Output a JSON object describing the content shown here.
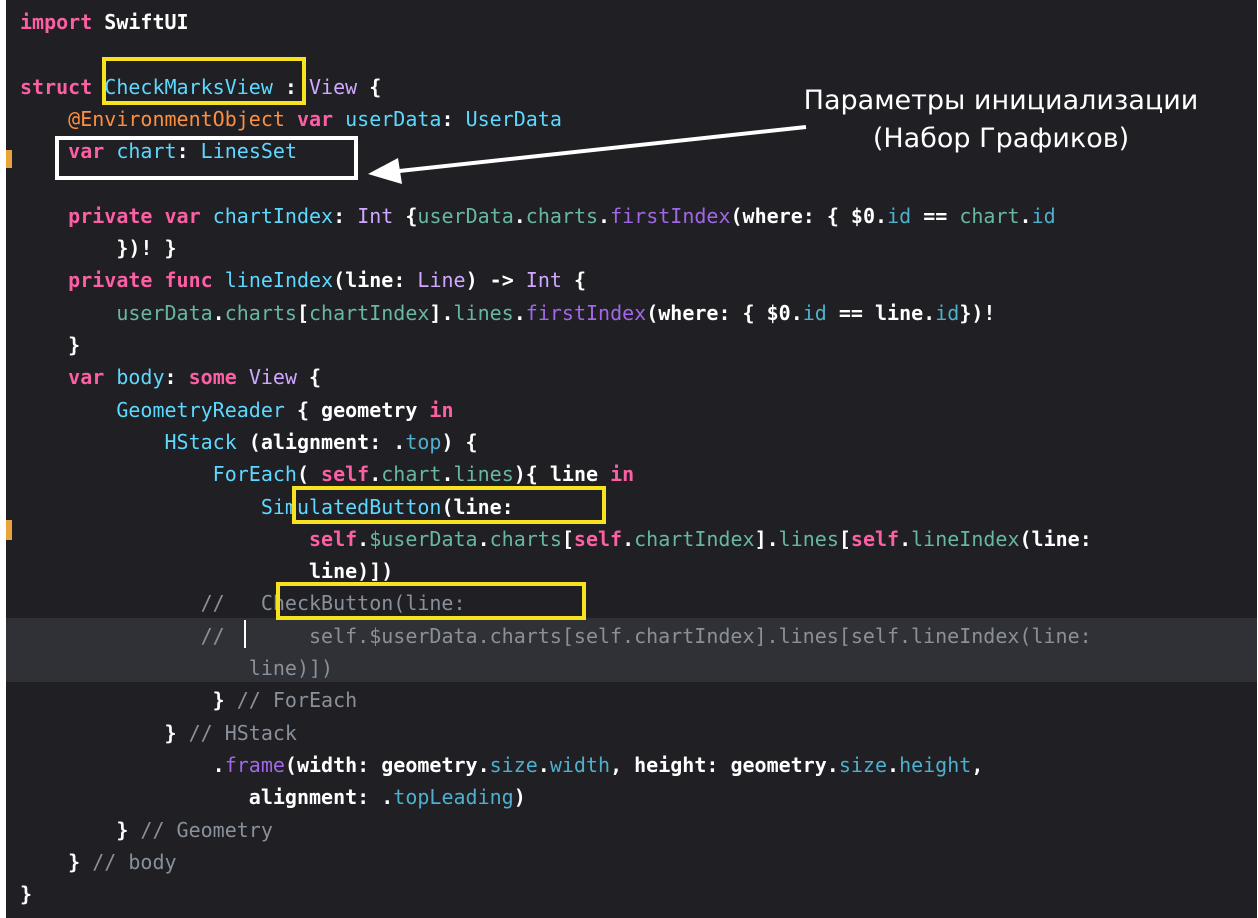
{
  "code_lines": [
    [
      {
        "t": "import",
        "c": "kw"
      },
      {
        "t": " SwiftUI",
        "c": "pl"
      }
    ],
    [],
    [
      {
        "t": "struct",
        "c": "kw"
      },
      {
        "t": " ",
        "c": "pl"
      },
      {
        "t": "CheckMarksView",
        "c": "ty"
      },
      {
        "t": " : ",
        "c": "pl"
      },
      {
        "t": "View",
        "c": "pt"
      },
      {
        "t": " {",
        "c": "pl"
      }
    ],
    [
      {
        "t": "    ",
        "c": "pl"
      },
      {
        "t": "@EnvironmentObject",
        "c": "at"
      },
      {
        "t": " ",
        "c": "pl"
      },
      {
        "t": "var",
        "c": "kw"
      },
      {
        "t": " ",
        "c": "pl"
      },
      {
        "t": "userData",
        "c": "ty"
      },
      {
        "t": ": ",
        "c": "pl"
      },
      {
        "t": "UserData",
        "c": "ty"
      }
    ],
    [
      {
        "t": "    ",
        "c": "pl"
      },
      {
        "t": "var",
        "c": "kw"
      },
      {
        "t": " ",
        "c": "pl"
      },
      {
        "t": "chart",
        "c": "ty"
      },
      {
        "t": ": ",
        "c": "pl"
      },
      {
        "t": "LinesSet",
        "c": "ty"
      }
    ],
    [],
    [
      {
        "t": "    ",
        "c": "pl"
      },
      {
        "t": "private",
        "c": "kw"
      },
      {
        "t": " ",
        "c": "pl"
      },
      {
        "t": "var",
        "c": "kw"
      },
      {
        "t": " ",
        "c": "pl"
      },
      {
        "t": "chartIndex",
        "c": "ty"
      },
      {
        "t": ": ",
        "c": "pl"
      },
      {
        "t": "Int",
        "c": "pt"
      },
      {
        "t": " {",
        "c": "pl"
      },
      {
        "t": "userData",
        "c": "fn"
      },
      {
        "t": ".",
        "c": "pl"
      },
      {
        "t": "charts",
        "c": "fn"
      },
      {
        "t": ".",
        "c": "pl"
      },
      {
        "t": "firstIndex",
        "c": "ob"
      },
      {
        "t": "(where: { $0.",
        "c": "pl"
      },
      {
        "t": "id",
        "c": "mb"
      },
      {
        "t": " == ",
        "c": "pl"
      },
      {
        "t": "chart",
        "c": "fn"
      },
      {
        "t": ".",
        "c": "pl"
      },
      {
        "t": "id",
        "c": "mb"
      }
    ],
    [
      {
        "t": "        })! }",
        "c": "pl"
      }
    ],
    [
      {
        "t": "    ",
        "c": "pl"
      },
      {
        "t": "private",
        "c": "kw"
      },
      {
        "t": " ",
        "c": "pl"
      },
      {
        "t": "func",
        "c": "kw"
      },
      {
        "t": " ",
        "c": "pl"
      },
      {
        "t": "lineIndex",
        "c": "ty"
      },
      {
        "t": "(line: ",
        "c": "pl"
      },
      {
        "t": "Line",
        "c": "pt"
      },
      {
        "t": ") -> ",
        "c": "pl"
      },
      {
        "t": "Int",
        "c": "pt"
      },
      {
        "t": " {",
        "c": "pl"
      }
    ],
    [
      {
        "t": "        ",
        "c": "pl"
      },
      {
        "t": "userData",
        "c": "fn"
      },
      {
        "t": ".",
        "c": "pl"
      },
      {
        "t": "charts",
        "c": "fn"
      },
      {
        "t": "[",
        "c": "pl"
      },
      {
        "t": "chartIndex",
        "c": "fn"
      },
      {
        "t": "].",
        "c": "pl"
      },
      {
        "t": "lines",
        "c": "fn"
      },
      {
        "t": ".",
        "c": "pl"
      },
      {
        "t": "firstIndex",
        "c": "ob"
      },
      {
        "t": "(where: { $0.",
        "c": "pl"
      },
      {
        "t": "id",
        "c": "mb"
      },
      {
        "t": " == line.",
        "c": "pl"
      },
      {
        "t": "id",
        "c": "mb"
      },
      {
        "t": "})!",
        "c": "pl"
      }
    ],
    [
      {
        "t": "    }",
        "c": "pl"
      }
    ],
    [
      {
        "t": "    ",
        "c": "pl"
      },
      {
        "t": "var",
        "c": "kw"
      },
      {
        "t": " ",
        "c": "pl"
      },
      {
        "t": "body",
        "c": "ty"
      },
      {
        "t": ": ",
        "c": "pl"
      },
      {
        "t": "some",
        "c": "kw"
      },
      {
        "t": " ",
        "c": "pl"
      },
      {
        "t": "View",
        "c": "pt"
      },
      {
        "t": " {",
        "c": "pl"
      }
    ],
    [
      {
        "t": "        ",
        "c": "pl"
      },
      {
        "t": "GeometryReader",
        "c": "ty"
      },
      {
        "t": " { geometry ",
        "c": "pl"
      },
      {
        "t": "in",
        "c": "kw"
      }
    ],
    [
      {
        "t": "            ",
        "c": "pl"
      },
      {
        "t": "HStack",
        "c": "ty"
      },
      {
        "t": " (alignment: .",
        "c": "pl"
      },
      {
        "t": "top",
        "c": "mb"
      },
      {
        "t": ") {",
        "c": "pl"
      }
    ],
    [
      {
        "t": "                ",
        "c": "pl"
      },
      {
        "t": "ForEach",
        "c": "ty"
      },
      {
        "t": "( ",
        "c": "pl"
      },
      {
        "t": "self",
        "c": "kw"
      },
      {
        "t": ".",
        "c": "pl"
      },
      {
        "t": "chart",
        "c": "fn"
      },
      {
        "t": ".",
        "c": "pl"
      },
      {
        "t": "lines",
        "c": "fn"
      },
      {
        "t": "){ line ",
        "c": "pl"
      },
      {
        "t": "in",
        "c": "kw"
      }
    ],
    [
      {
        "t": "                    ",
        "c": "pl"
      },
      {
        "t": "SimulatedButton",
        "c": "ty"
      },
      {
        "t": "(line:",
        "c": "pl"
      }
    ],
    [
      {
        "t": "                        ",
        "c": "pl"
      },
      {
        "t": "self",
        "c": "kw"
      },
      {
        "t": ".",
        "c": "pl"
      },
      {
        "t": "$userData",
        "c": "fn"
      },
      {
        "t": ".",
        "c": "pl"
      },
      {
        "t": "charts",
        "c": "fn"
      },
      {
        "t": "[",
        "c": "pl"
      },
      {
        "t": "self",
        "c": "kw"
      },
      {
        "t": ".",
        "c": "pl"
      },
      {
        "t": "chartIndex",
        "c": "fn"
      },
      {
        "t": "].",
        "c": "pl"
      },
      {
        "t": "lines",
        "c": "fn"
      },
      {
        "t": "[",
        "c": "pl"
      },
      {
        "t": "self",
        "c": "kw"
      },
      {
        "t": ".",
        "c": "pl"
      },
      {
        "t": "lineIndex",
        "c": "fn"
      },
      {
        "t": "(line:",
        "c": "pl"
      }
    ],
    [
      {
        "t": "                        line)])",
        "c": "pl"
      }
    ],
    [
      {
        "t": "               //   CheckButton(line:",
        "c": "cm"
      }
    ],
    [
      {
        "t": "               ",
        "c": "pl"
      },
      {
        "t": "//       self.$userData.charts[self.chartIndex].lines[self.lineIndex(line:",
        "c": "cm"
      }
    ],
    [
      {
        "t": "                   line)])",
        "c": "cm"
      }
    ],
    [
      {
        "t": "                ",
        "c": "pl"
      },
      {
        "t": "}",
        "c": "pl"
      },
      {
        "t": " // ForEach",
        "c": "cm"
      }
    ],
    [
      {
        "t": "            ",
        "c": "pl"
      },
      {
        "t": "}",
        "c": "pl"
      },
      {
        "t": " // HStack",
        "c": "cm"
      }
    ],
    [
      {
        "t": "                .",
        "c": "pl"
      },
      {
        "t": "frame",
        "c": "ob"
      },
      {
        "t": "(width: geometry.",
        "c": "pl"
      },
      {
        "t": "size",
        "c": "mb"
      },
      {
        "t": ".",
        "c": "pl"
      },
      {
        "t": "width",
        "c": "mb"
      },
      {
        "t": ", height: geometry.",
        "c": "pl"
      },
      {
        "t": "size",
        "c": "mb"
      },
      {
        "t": ".",
        "c": "pl"
      },
      {
        "t": "height",
        "c": "mb"
      },
      {
        "t": ",",
        "c": "pl"
      }
    ],
    [
      {
        "t": "                   alignment: .",
        "c": "pl"
      },
      {
        "t": "topLeading",
        "c": "mb"
      },
      {
        "t": ")",
        "c": "pl"
      }
    ],
    [
      {
        "t": "        ",
        "c": "pl"
      },
      {
        "t": "}",
        "c": "pl"
      },
      {
        "t": " // Geometry",
        "c": "cm"
      }
    ],
    [
      {
        "t": "    ",
        "c": "pl"
      },
      {
        "t": "}",
        "c": "pl"
      },
      {
        "t": " // body",
        "c": "cm"
      }
    ],
    [
      {
        "t": "}",
        "c": "pl"
      }
    ]
  ],
  "annotation": {
    "line1": "Параметры инициализации",
    "line2": "(Набор Графиков)"
  },
  "colors": {
    "editor_bg": "#1f1f24",
    "highlight_box_yellow": "#f6e21f",
    "highlight_box_white": "#ffffff"
  }
}
